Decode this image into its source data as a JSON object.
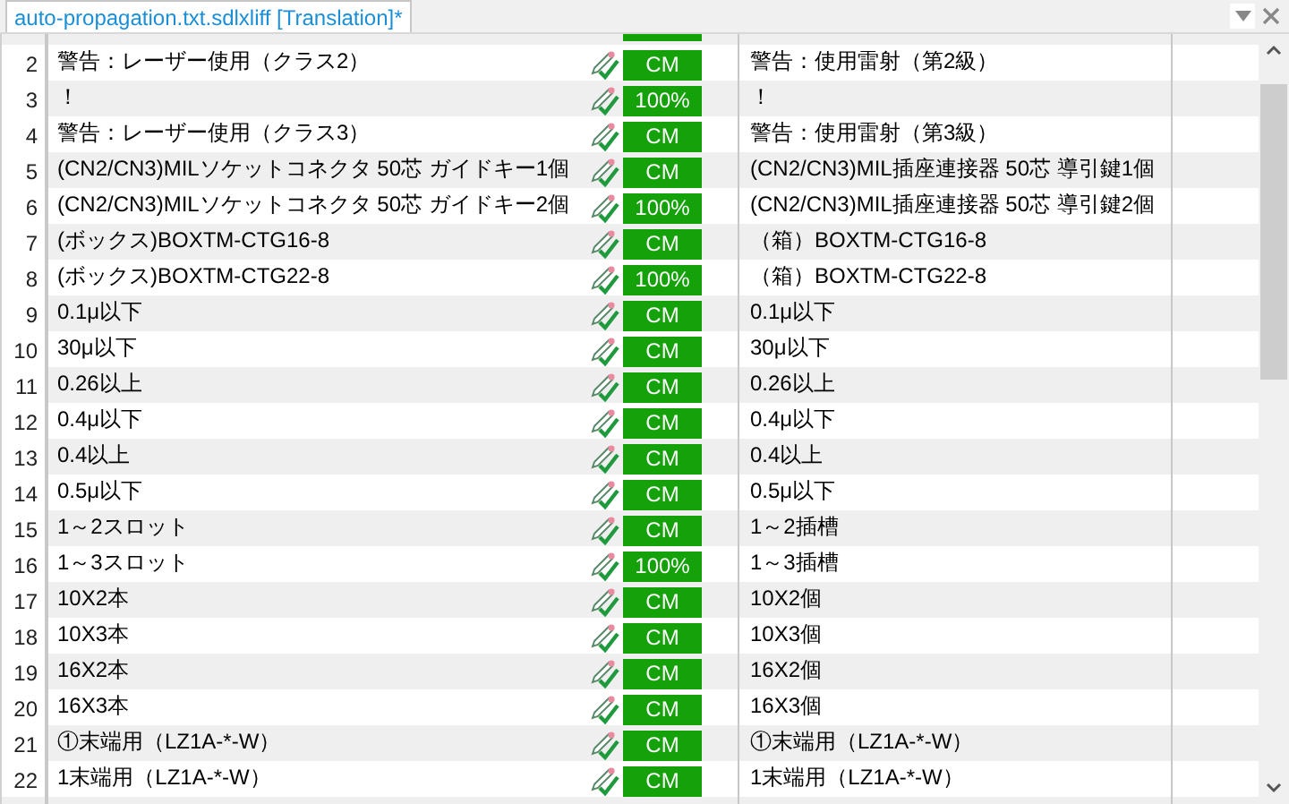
{
  "tab": {
    "title": "auto-propagation.txt.sdlxliff [Translation]*",
    "selected": true
  },
  "rows": [
    {
      "number": "2",
      "source": "警告：レーザー使用（クラス2）",
      "status": "CM",
      "target": "警告：使用雷射（第2級）"
    },
    {
      "number": "3",
      "source": "！",
      "status": "100%",
      "target": "！"
    },
    {
      "number": "4",
      "source": "警告：レーザー使用（クラス3）",
      "status": "CM",
      "target": "警告：使用雷射（第3級）"
    },
    {
      "number": "5",
      "source": "(CN2/CN3)MILソケットコネクタ 50芯 ガイドキー1個",
      "status": "CM",
      "target": "(CN2/CN3)MIL插座連接器 50芯 導引鍵1個"
    },
    {
      "number": "6",
      "source": "(CN2/CN3)MILソケットコネクタ 50芯 ガイドキー2個",
      "status": "100%",
      "target": "(CN2/CN3)MIL插座連接器 50芯 導引鍵2個"
    },
    {
      "number": "7",
      "source": "(ボックス)BOXTM-CTG16-8",
      "status": "CM",
      "target": "（箱）BOXTM-CTG16-8"
    },
    {
      "number": "8",
      "source": "(ボックス)BOXTM-CTG22-8",
      "status": "100%",
      "target": "（箱）BOXTM-CTG22-8"
    },
    {
      "number": "9",
      "source": "0.1μ以下",
      "status": "CM",
      "target": "0.1μ以下"
    },
    {
      "number": "10",
      "source": "30μ以下",
      "status": "CM",
      "target": "30μ以下"
    },
    {
      "number": "11",
      "source": "0.26以上",
      "status": "CM",
      "target": "0.26以上"
    },
    {
      "number": "12",
      "source": "0.4μ以下",
      "status": "CM",
      "target": "0.4μ以下"
    },
    {
      "number": "13",
      "source": "0.4以上",
      "status": "CM",
      "target": "0.4以上"
    },
    {
      "number": "14",
      "source": "0.5μ以下",
      "status": "CM",
      "target": "0.5μ以下"
    },
    {
      "number": "15",
      "source": "1～2スロット",
      "status": "CM",
      "target": "1～2插槽"
    },
    {
      "number": "16",
      "source": "1～3スロット",
      "status": "100%",
      "target": "1～3插槽"
    },
    {
      "number": "17",
      "source": "10X2本",
      "status": "CM",
      "target": "10X2個"
    },
    {
      "number": "18",
      "source": "10X3本",
      "status": "CM",
      "target": "10X3個"
    },
    {
      "number": "19",
      "source": "16X2本",
      "status": "CM",
      "target": "16X2個"
    },
    {
      "number": "20",
      "source": "16X3本",
      "status": "CM",
      "target": "16X3個"
    },
    {
      "number": "21",
      "source": "①末端用（LZ1A-*-W）",
      "status": "CM",
      "target": "①末端用（LZ1A-*-W）"
    },
    {
      "number": "22",
      "source": "1末端用（LZ1A-*-W）",
      "status": "CM",
      "target": "1末端用（LZ1A-*-W）"
    }
  ]
}
